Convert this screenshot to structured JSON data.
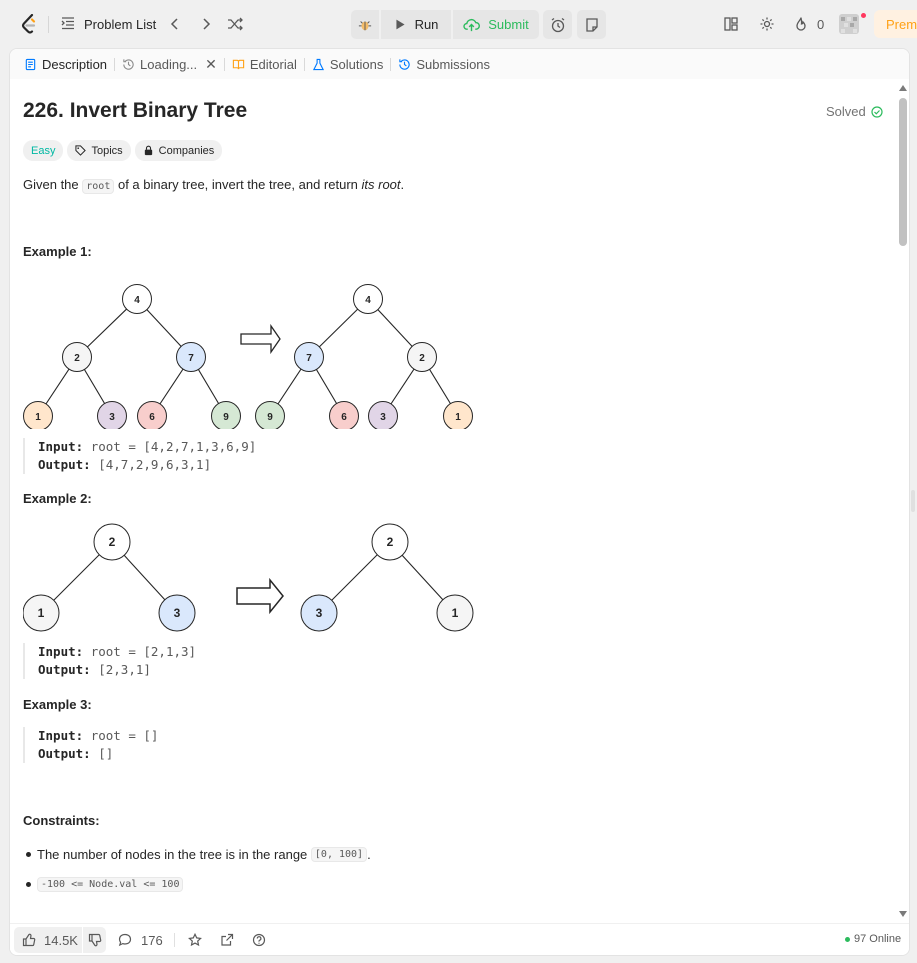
{
  "header": {
    "problem_list_label": "Problem List",
    "run_label": "Run",
    "submit_label": "Submit",
    "streak_count": "0",
    "premium_label": "Premium"
  },
  "tabs": [
    {
      "label": "Description",
      "icon": "description-icon"
    },
    {
      "label": "Loading...",
      "icon": "history-icon"
    },
    {
      "label": "Editorial",
      "icon": "book-icon"
    },
    {
      "label": "Solutions",
      "icon": "flask-icon"
    },
    {
      "label": "Submissions",
      "icon": "history-icon"
    }
  ],
  "problem": {
    "title": "226. Invert Binary Tree",
    "status": "Solved",
    "difficulty": "Easy",
    "topics_label": "Topics",
    "companies_label": "Companies",
    "desc_pre": "Given the ",
    "desc_code": "root",
    "desc_mid": " of a binary tree, invert the tree, and return ",
    "desc_em": "its root",
    "desc_post": "."
  },
  "examples": [
    {
      "heading": "Example 1:",
      "input_label": "Input:",
      "input": "root = [4,2,7,1,3,6,9]",
      "output_label": "Output:",
      "output": "[4,7,2,9,6,3,1]",
      "tree_before": [
        "4",
        "2",
        "7",
        "1",
        "3",
        "6",
        "9"
      ],
      "tree_after": [
        "4",
        "7",
        "2",
        "9",
        "6",
        "3",
        "1"
      ]
    },
    {
      "heading": "Example 2:",
      "input_label": "Input:",
      "input": "root = [2,1,3]",
      "output_label": "Output:",
      "output": "[2,3,1]",
      "tree_before": [
        "2",
        "1",
        "3"
      ],
      "tree_after": [
        "2",
        "3",
        "1"
      ]
    },
    {
      "heading": "Example 3:",
      "input_label": "Input:",
      "input": "root = []",
      "output_label": "Output:",
      "output": "[]"
    }
  ],
  "constraints": {
    "heading": "Constraints:",
    "item1_text": "The number of nodes in the tree is in the range ",
    "item1_code": "[0, 100]",
    "item1_post": ".",
    "item2_code": "-100 <= Node.val <= 100"
  },
  "footer": {
    "likes": "14.5K",
    "comments": "176",
    "online": "97 Online"
  },
  "colors": {
    "brand_orange": "#ffa116",
    "submit_green": "#2cbb5d",
    "easy_teal": "#00b8a3",
    "node_blue": "#dae8fc",
    "node_red": "#f8cecc",
    "node_orange": "#ffe6cc",
    "node_purple": "#e1d5e7",
    "node_green": "#d5e8d4",
    "node_gray": "#f5f5f5"
  }
}
